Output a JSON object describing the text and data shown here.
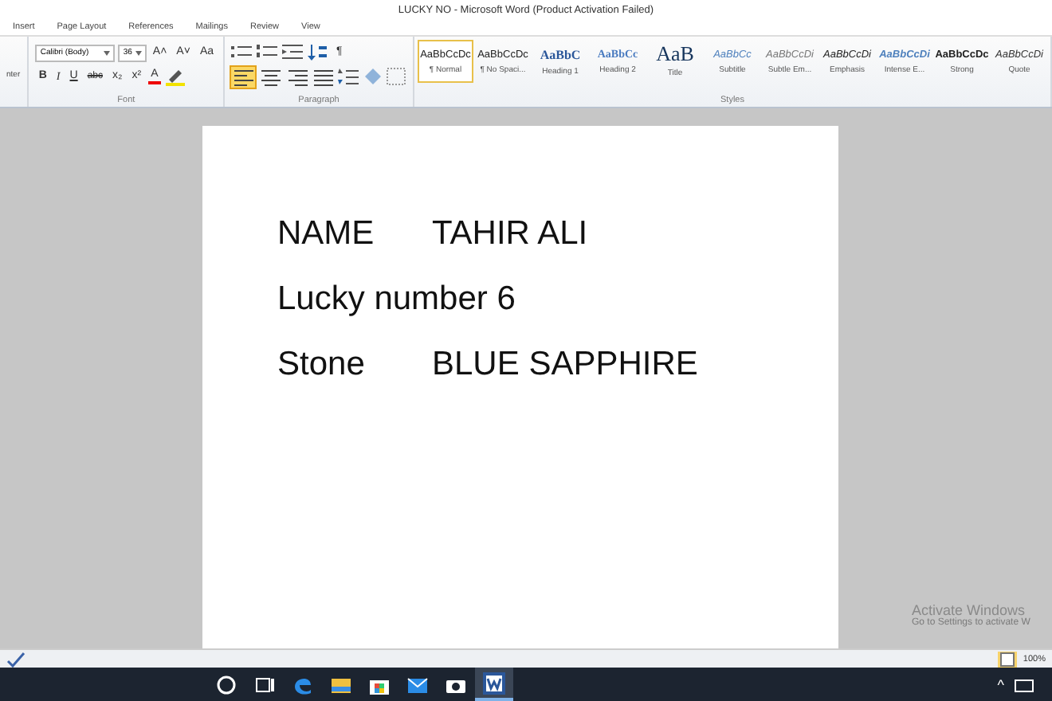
{
  "window": {
    "title": "LUCKY NO  -  Microsoft Word (Product Activation Failed)"
  },
  "tabs": [
    {
      "label": "Insert",
      "selected": false
    },
    {
      "label": "Page Layout",
      "selected": false
    },
    {
      "label": "References",
      "selected": false
    },
    {
      "label": "Mailings",
      "selected": false
    },
    {
      "label": "Review",
      "selected": false
    },
    {
      "label": "View",
      "selected": false
    }
  ],
  "clipboard": {
    "cut_label": "nter"
  },
  "font": {
    "name": "Calibri (Body)",
    "size": "36",
    "group_label": "Font",
    "tools": [
      {
        "label": "B",
        "kind": "bold"
      },
      {
        "label": "I",
        "kind": "italic"
      },
      {
        "label": "U",
        "kind": "underline"
      },
      {
        "label": "abc",
        "kind": "strike"
      },
      {
        "label": "x₂",
        "kind": "plain"
      },
      {
        "label": "x²",
        "kind": "plain"
      },
      {
        "label": "A",
        "kind": "color"
      }
    ],
    "size_tools": [
      "A˄",
      "A˅",
      "Aa"
    ]
  },
  "paragraph": {
    "group_label": "Paragraph",
    "pilcrow": "¶",
    "alignments": [
      {
        "selected": true
      },
      {
        "selected": false
      },
      {
        "selected": false
      },
      {
        "selected": false
      }
    ]
  },
  "styles": {
    "group_label": "Styles",
    "items": [
      {
        "preview": "AaBbCcDc",
        "name": "¶ Normal",
        "kind": "normal",
        "selected": true
      },
      {
        "preview": "AaBbCcDc",
        "name": "¶ No Spaci...",
        "kind": "normal",
        "selected": false
      },
      {
        "preview": "AaBbC",
        "name": "Heading 1",
        "kind": "heading1",
        "selected": false
      },
      {
        "preview": "AaBbCc",
        "name": "Heading 2",
        "kind": "heading2",
        "selected": false
      },
      {
        "preview": "AaB",
        "name": "Title",
        "kind": "title",
        "selected": false
      },
      {
        "preview": "AaBbCc",
        "name": "Subtitle",
        "kind": "subtitle",
        "selected": false
      },
      {
        "preview": "AaBbCcDi",
        "name": "Subtle Em...",
        "kind": "subtle",
        "selected": false
      },
      {
        "preview": "AaBbCcDi",
        "name": "Emphasis",
        "kind": "emphasis",
        "selected": false
      },
      {
        "preview": "AaBbCcDi",
        "name": "Intense E...",
        "kind": "intense",
        "selected": false
      },
      {
        "preview": "AaBbCcDc",
        "name": "Strong",
        "kind": "strong",
        "selected": false
      },
      {
        "preview": "AaBbCcDi",
        "name": "Quote",
        "kind": "quote",
        "selected": false
      }
    ]
  },
  "document": {
    "lines": [
      [
        "NAME",
        "TAHIR ALI"
      ],
      [
        "Lucky number 6"
      ],
      [
        "Stone",
        "BLUE SAPPHIRE"
      ]
    ]
  },
  "activation": {
    "title": "Activate Windows",
    "message": "Go to Settings to activate W"
  },
  "status_bar": {
    "zoom": "100%"
  },
  "taskbar": {
    "apps": [
      {
        "kind": "cortana",
        "active": false
      },
      {
        "kind": "taskview",
        "active": false
      },
      {
        "kind": "edge",
        "active": false
      },
      {
        "kind": "explorer",
        "active": false
      },
      {
        "kind": "store",
        "active": false
      },
      {
        "kind": "mail",
        "active": false
      },
      {
        "kind": "camera",
        "active": false
      },
      {
        "kind": "word",
        "active": true
      }
    ],
    "tray": "^"
  }
}
